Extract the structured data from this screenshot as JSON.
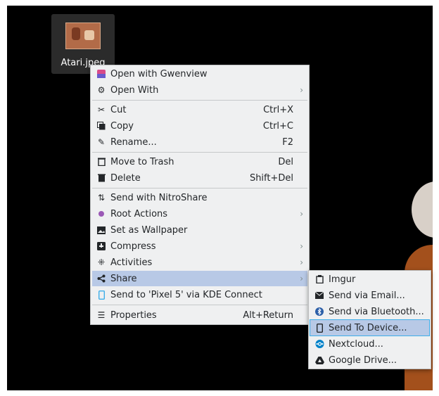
{
  "file": {
    "name": "Atari.jpeg"
  },
  "main_menu": [
    {
      "label": "Open with Gwenview",
      "icon": "gwenview-icon"
    },
    {
      "label": "Open With",
      "icon": "open-with-icon",
      "submenu": true
    },
    {
      "label": "Cut",
      "icon": "cut-icon",
      "shortcut": "Ctrl+X"
    },
    {
      "label": "Copy",
      "icon": "copy-icon",
      "shortcut": "Ctrl+C"
    },
    {
      "label": "Rename...",
      "icon": "rename-icon",
      "shortcut": "F2"
    },
    {
      "label": "Move to Trash",
      "icon": "trash-icon",
      "shortcut": "Del"
    },
    {
      "label": "Delete",
      "icon": "delete-icon",
      "shortcut": "Shift+Del"
    },
    {
      "label": "Send with NitroShare",
      "icon": "nitroshare-icon"
    },
    {
      "label": "Root Actions",
      "icon": "root-actions-icon",
      "submenu": true
    },
    {
      "label": "Set as Wallpaper",
      "icon": "wallpaper-icon"
    },
    {
      "label": "Compress",
      "icon": "compress-icon",
      "submenu": true
    },
    {
      "label": "Activities",
      "icon": "activities-icon",
      "submenu": true
    },
    {
      "label": "Share",
      "icon": "share-icon",
      "submenu": true,
      "highlighted": true
    },
    {
      "label": "Send to 'Pixel 5' via KDE Connect",
      "icon": "kdeconnect-icon"
    },
    {
      "label": "Properties",
      "icon": "properties-icon",
      "shortcut": "Alt+Return"
    }
  ],
  "share_menu": [
    {
      "label": "Imgur",
      "icon": "imgur-icon"
    },
    {
      "label": "Send via Email...",
      "icon": "email-icon"
    },
    {
      "label": "Send via Bluetooth...",
      "icon": "bluetooth-icon"
    },
    {
      "label": "Send To Device...",
      "icon": "device-icon",
      "highlighted": true
    },
    {
      "label": "Nextcloud...",
      "icon": "nextcloud-icon"
    },
    {
      "label": "Google Drive...",
      "icon": "google-drive-icon"
    }
  ],
  "colors": {
    "highlight": "#b8c9e6",
    "menu_bg": "#eff0f1",
    "accent": "#3daee9"
  }
}
